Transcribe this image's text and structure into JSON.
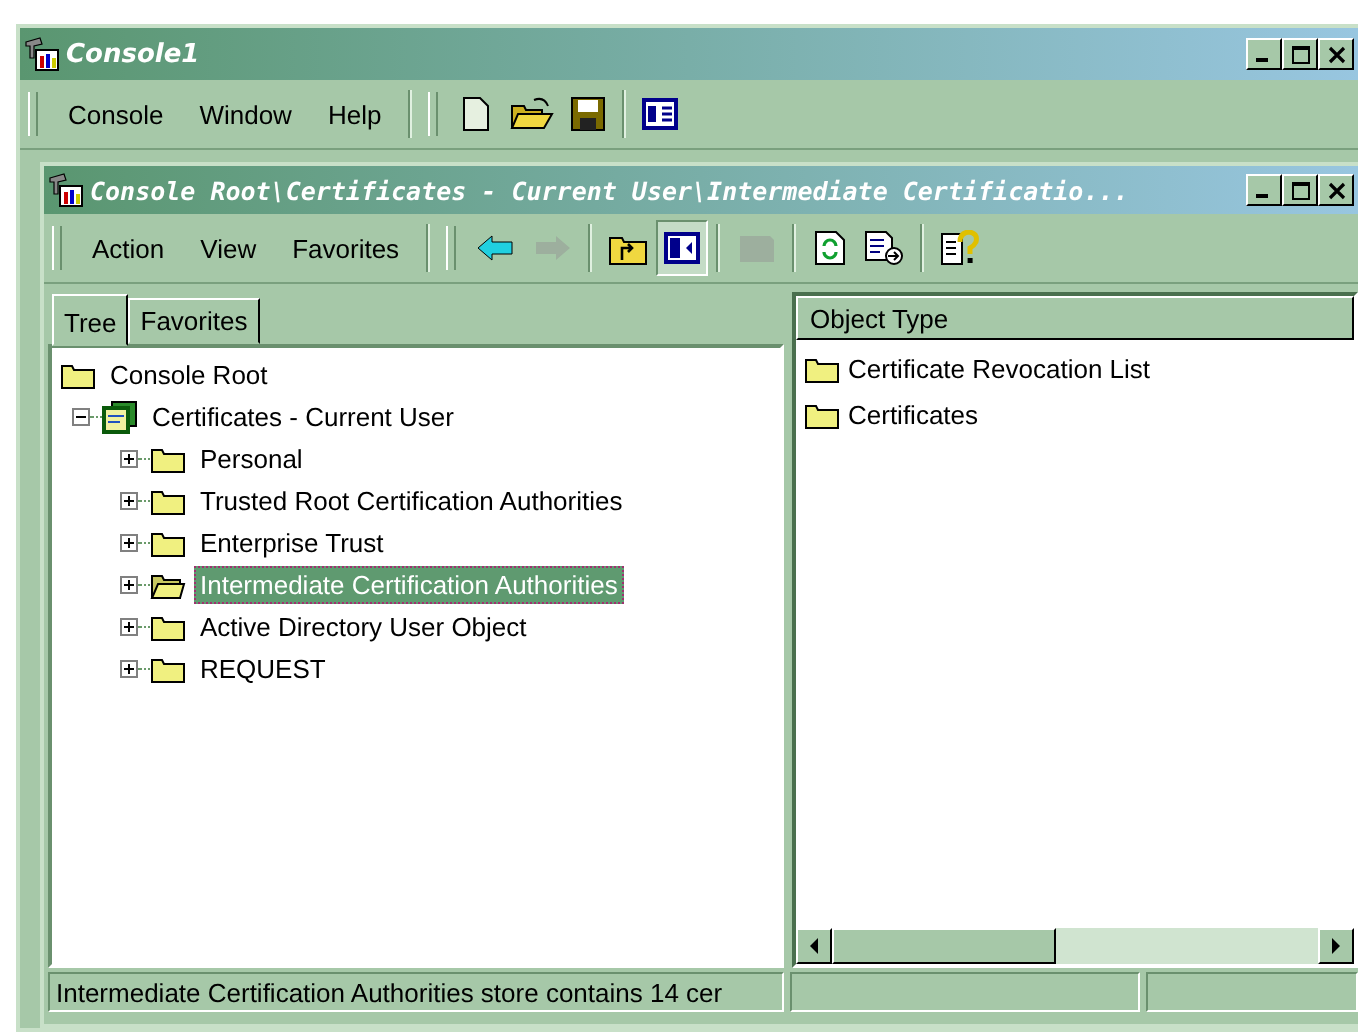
{
  "window": {
    "title": "Console1"
  },
  "menu": [
    "Console",
    "Window",
    "Help"
  ],
  "main_toolbar": [
    {
      "kind": "new"
    },
    {
      "kind": "open"
    },
    {
      "kind": "save"
    },
    {
      "kind": "sep"
    },
    {
      "kind": "panes"
    }
  ],
  "child_window": {
    "title": "Console Root\\Certificates - Current User\\Intermediate Certificatio..."
  },
  "child_menu": [
    "Action",
    "View",
    "Favorites"
  ],
  "child_toolbar": [
    {
      "kind": "back",
      "disabled": false,
      "pressed": false
    },
    {
      "kind": "forward",
      "disabled": true,
      "pressed": false
    },
    {
      "kind": "sep"
    },
    {
      "kind": "up",
      "disabled": false,
      "pressed": false
    },
    {
      "kind": "tree",
      "disabled": false,
      "pressed": true
    },
    {
      "kind": "sep"
    },
    {
      "kind": "blank",
      "disabled": true,
      "pressed": false
    },
    {
      "kind": "sep"
    },
    {
      "kind": "refresh",
      "disabled": false,
      "pressed": false
    },
    {
      "kind": "export",
      "disabled": false,
      "pressed": false
    },
    {
      "kind": "sep"
    },
    {
      "kind": "help",
      "disabled": false,
      "pressed": false
    }
  ],
  "tabs": [
    {
      "label": "Tree",
      "selected": true
    },
    {
      "label": "Favorites",
      "selected": false
    }
  ],
  "tree": [
    {
      "label": "Console Root",
      "kind": "folder",
      "selected": false,
      "children": [
        {
          "label": "Certificates - Current User",
          "kind": "snapin",
          "selected": false,
          "expanded": true,
          "children": [
            {
              "label": "Personal",
              "kind": "folder",
              "selected": false,
              "expanded": false
            },
            {
              "label": "Trusted Root Certification Authorities",
              "kind": "folder",
              "selected": false,
              "expanded": false
            },
            {
              "label": "Enterprise Trust",
              "kind": "folder",
              "selected": false,
              "expanded": false
            },
            {
              "label": "Intermediate Certification Authorities",
              "kind": "folder",
              "selected": true,
              "expanded": false
            },
            {
              "label": "Active Directory User Object",
              "kind": "folder",
              "selected": false,
              "expanded": false
            },
            {
              "label": "REQUEST",
              "kind": "folder",
              "selected": false,
              "expanded": false
            }
          ]
        }
      ]
    }
  ],
  "list": {
    "columns": [
      "Object Type"
    ],
    "rows": [
      "Certificate Revocation List",
      "Certificates"
    ]
  },
  "status_bar": [
    "Intermediate Certification Authorities store contains 14 cer"
  ]
}
